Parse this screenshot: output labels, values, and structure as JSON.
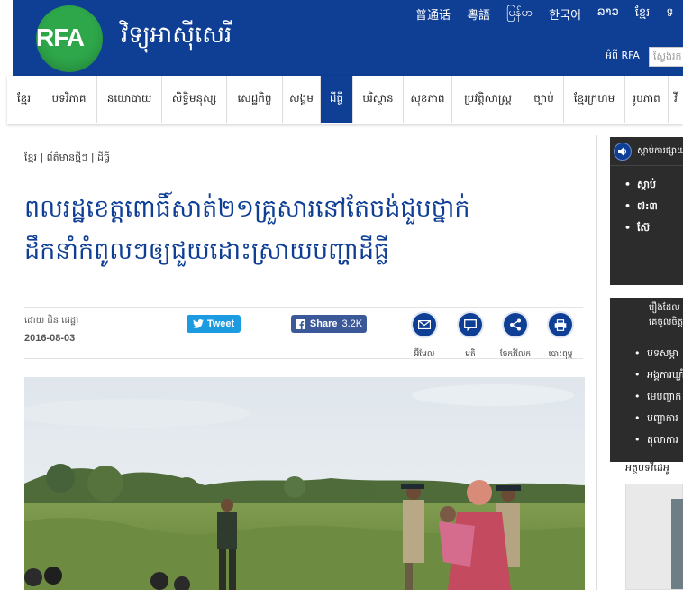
{
  "site": {
    "logo_text": "RFA",
    "name": "វិទ្យុអាស៊ីសេរី",
    "languages": [
      "普通话",
      "粵語",
      "မြန်မာ",
      "한국어",
      "ລາວ",
      "ខ្មែរ",
      "ទ"
    ],
    "about_link": "អំពី RFA",
    "search_placeholder": "ស្វែងរក"
  },
  "nav": {
    "items": [
      "ខ្មែរ",
      "បទវិភាគ",
      "នយោបាយ",
      "សិទ្ធិមនុស្ស",
      "សេដ្ឋកិច្ច",
      "សង្គម",
      "ដីធ្លី",
      "បរិស្ថាន",
      "សុខភាព",
      "ប្រវត្តិសាស្ត្រ",
      "ច្បាប់",
      "ខ្មែរក្រហម",
      "រូបភាព",
      "វី"
    ],
    "active": "ដីធ្លី"
  },
  "article": {
    "breadcrumb": "ខ្មែរ | ព័ត៌មានថ្មីៗ | ដីធ្លី",
    "title_line1": "ពលរដ្ឋខេត្តពោធិ៍សាត់២១គ្រួសារនៅតែចង់ជួបថ្នាក់",
    "title_line2": "ដឹកនាំកំពូលៗឲ្យជួយដោះស្រាយបញ្ហាដីធ្លី",
    "byline": "ដោយ ជិន ជេដ្ឋា",
    "date": "2016-08-03",
    "tweet_label": "Tweet",
    "share_label": "Share",
    "share_count": "3.2K",
    "tools": [
      {
        "label": "អ៊ីមែល",
        "icon": "email-icon"
      },
      {
        "label": "មតិ",
        "icon": "comment-icon"
      },
      {
        "label": "ចែករំលែក",
        "icon": "share-icon"
      },
      {
        "label": "បោះពុម្ព",
        "icon": "print-icon"
      }
    ]
  },
  "sidebar": {
    "listen_title": "ស្ដាប់ការផ្សាយ",
    "listen_items": [
      "ស្ដាប់",
      "៧:៣",
      "ស៊ែ"
    ],
    "stories_title_lines": [
      "រឿងដែល",
      "គេចូលចិត្ត"
    ],
    "stories_items": [
      "បទសម្ភា",
      "អង្គការឃ្លាំ",
      "មេបញ្ជាក",
      "បញ្ហាការ",
      "តុលាការ"
    ],
    "video_title": "អត្ថបទវីដេអូ"
  },
  "colors": {
    "brand_blue": "#0f3f95",
    "logo_green": "#2ea64a",
    "twitter": "#1d9be0",
    "facebook": "#3b5998",
    "sidebar_dark": "#2c2c2c"
  }
}
